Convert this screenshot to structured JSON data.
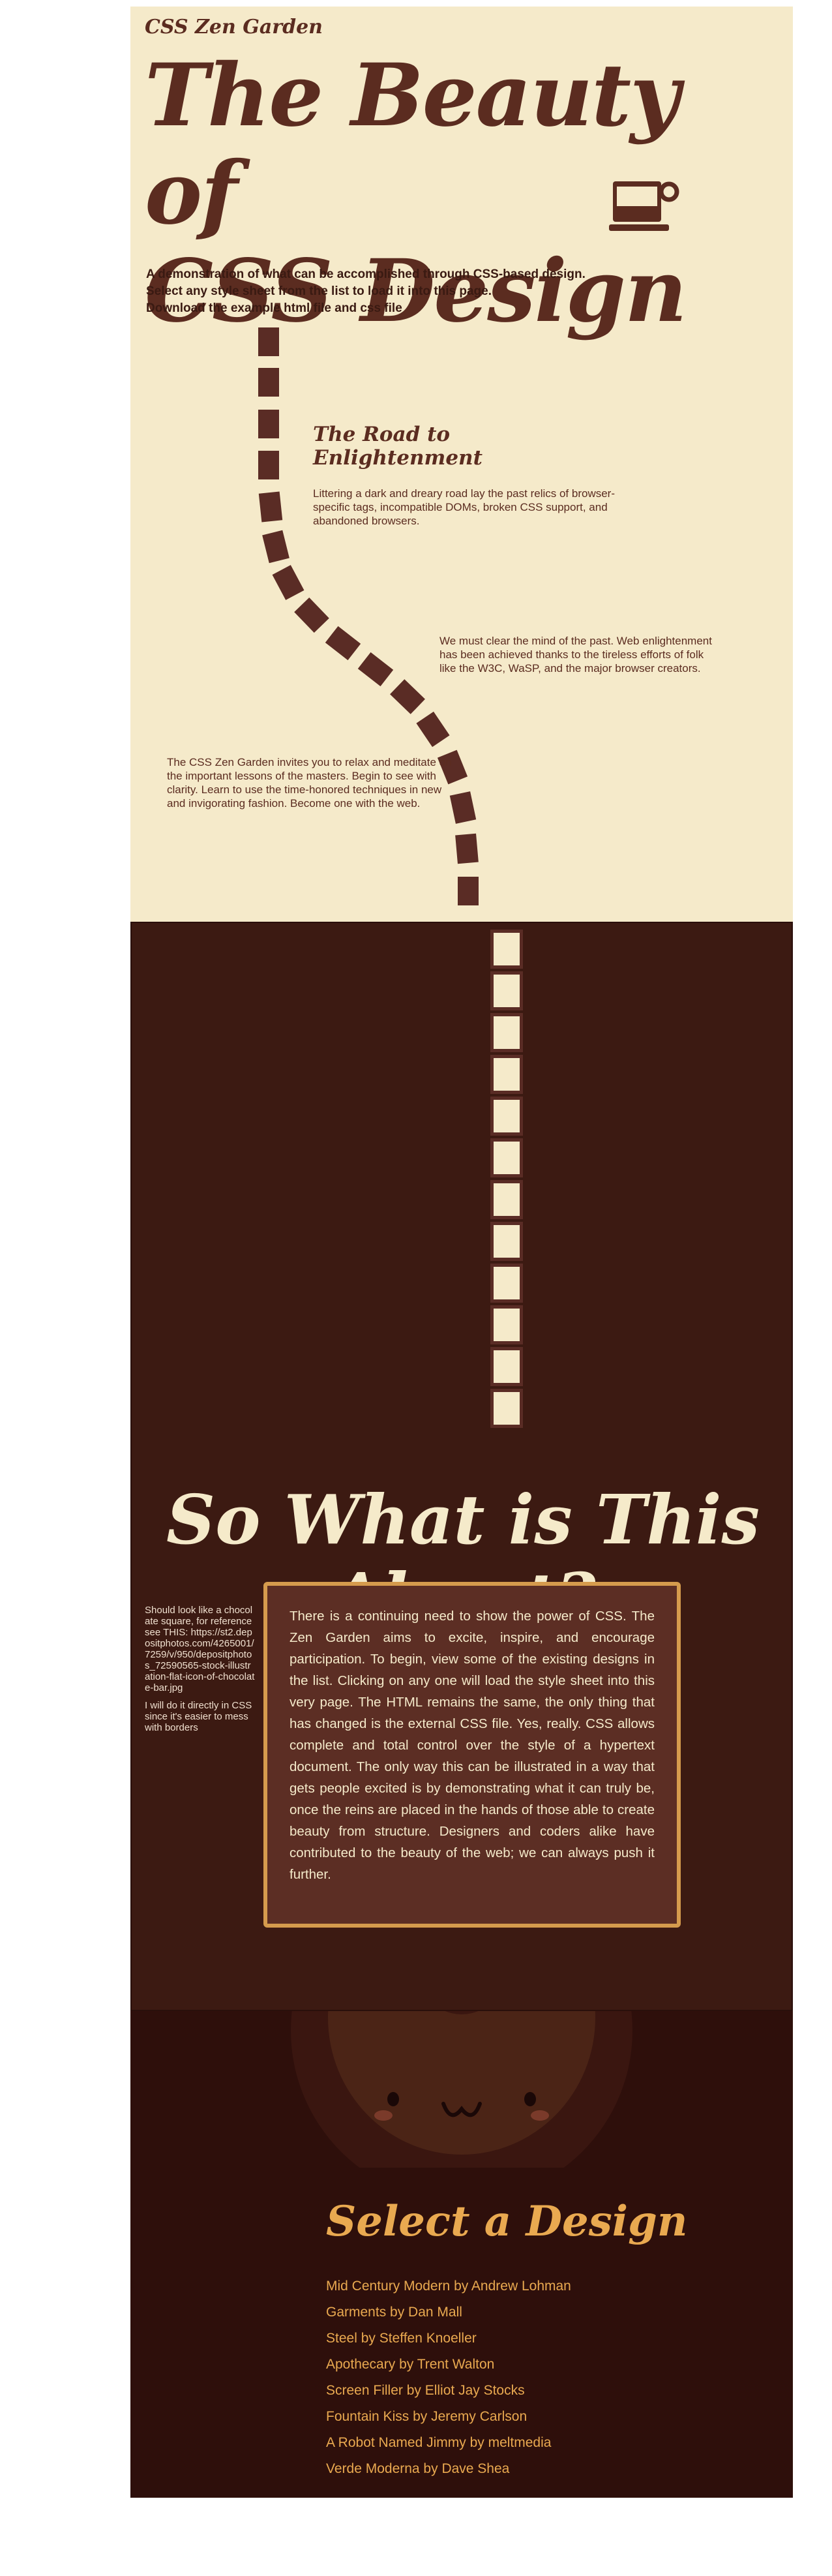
{
  "site": {
    "name": "CSS Zen Garden"
  },
  "header": {
    "title_line1": "The Beauty of",
    "title_line2": "CSS Design"
  },
  "summary": {
    "line1": "A demonstration of what can be accomplished through CSS-based design.",
    "line2": "Select any style sheet from the list to load it into this page.",
    "line3": "Download the example html file and css file"
  },
  "road": {
    "heading": "The Road to Enlightenment",
    "para1": "Littering a dark and dreary road lay the past relics of browser-specific tags, incompatible DOMs, broken CSS support, and abandoned browsers.",
    "para2": "We must clear the mind of the past. Web enlightenment has been achieved thanks to the tireless efforts of folk like the W3C, WaSP, and the major browser creators.",
    "para3": "The CSS Zen Garden invites you to relax and meditate on the important lessons of the masters. Begin to see with clarity. Learn to use the time-honored techniques in new and invigorating fashion. Become one with the web."
  },
  "about": {
    "heading": "So What is This About?",
    "body": "There is a continuing need to show the power of CSS. The Zen Garden aims to excite, inspire, and encourage participation. To begin, view some of the existing designs in the list. Clicking on any one will load the style sheet into this very page. The HTML remains the same, the only thing that has changed is the external CSS file. Yes, really. CSS allows complete and total control over the style of a hypertext document. The only way this can be illustrated in a way that gets people excited is by demonstrating what it can truly be, once the reins are placed in the hands of those able to create beauty from structure. Designers and coders alike have contributed to the beauty of the web; we can always push it further.",
    "side_note1": "Should look like a chocolate square, for reference see THIS: https://st2.depositphotos.com/4265001/7259/v/950/depositphotos_72590565-stock-illustration-flat-icon-of-chocolate-bar.jpg",
    "side_note2": "I will do it directly in CSS since it's easier to mess with borders"
  },
  "designs": {
    "heading": "Select a Design",
    "items": [
      {
        "label": "Mid Century Modern by Andrew Lohman"
      },
      {
        "label": "Garments by Dan Mall"
      },
      {
        "label": "Steel by Steffen Knoeller"
      },
      {
        "label": "Apothecary by Trent Walton"
      },
      {
        "label": "Screen Filler by Elliot Jay Stocks"
      },
      {
        "label": "Fountain Kiss by Jeremy Carlson"
      },
      {
        "label": "A Robot Named Jimmy by meltmedia"
      },
      {
        "label": "Verde Moderna by Dave Shea"
      }
    ]
  },
  "icons": {
    "cup": "coffee-cup-icon",
    "mascot": "smiling-face-icon"
  },
  "colors": {
    "cream": "#f5eaca",
    "brown": "#5b2c20",
    "dark": "#3c1a12",
    "darker": "#2e0f0b",
    "accent": "#e9a950",
    "box_border": "#d59b4d"
  }
}
